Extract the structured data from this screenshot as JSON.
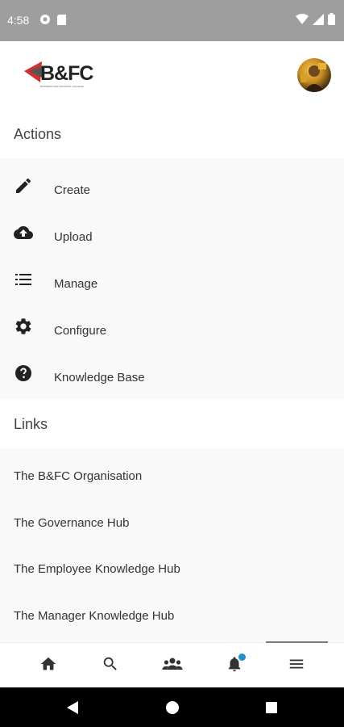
{
  "status_bar": {
    "time": "4:58",
    "icons_left": [
      "camera-icon",
      "sim-icon"
    ],
    "icons_right": [
      "wifi-icon",
      "signal-icon",
      "battery-icon"
    ]
  },
  "header": {
    "logo_text": "B&FC",
    "logo_tagline": "BUSINESS AND FINANCIAL COLLEGE",
    "brand_accent": "#d32f2f",
    "avatar": "user-avatar"
  },
  "actions": {
    "title": "Actions",
    "items": [
      {
        "label": "Create",
        "icon": "pencil-icon"
      },
      {
        "label": "Upload",
        "icon": "cloud-upload-icon"
      },
      {
        "label": "Manage",
        "icon": "list-icon"
      },
      {
        "label": "Configure",
        "icon": "gear-icon"
      },
      {
        "label": "Knowledge Base",
        "icon": "help-icon"
      }
    ]
  },
  "links": {
    "title": "Links",
    "items": [
      {
        "label": "The B&FC Organisation"
      },
      {
        "label": "The Governance Hub"
      },
      {
        "label": "The Employee Knowledge Hub"
      },
      {
        "label": "The Manager Knowledge Hub"
      }
    ]
  },
  "bottom_nav": {
    "items": [
      {
        "icon": "home-icon"
      },
      {
        "icon": "search-icon"
      },
      {
        "icon": "people-icon"
      },
      {
        "icon": "bell-icon"
      },
      {
        "icon": "menu-icon"
      }
    ],
    "active": "menu-icon",
    "notification_color": "#1f8fd6"
  },
  "android_nav": {
    "buttons": [
      "back-icon",
      "home-circle-icon",
      "recents-icon"
    ]
  }
}
